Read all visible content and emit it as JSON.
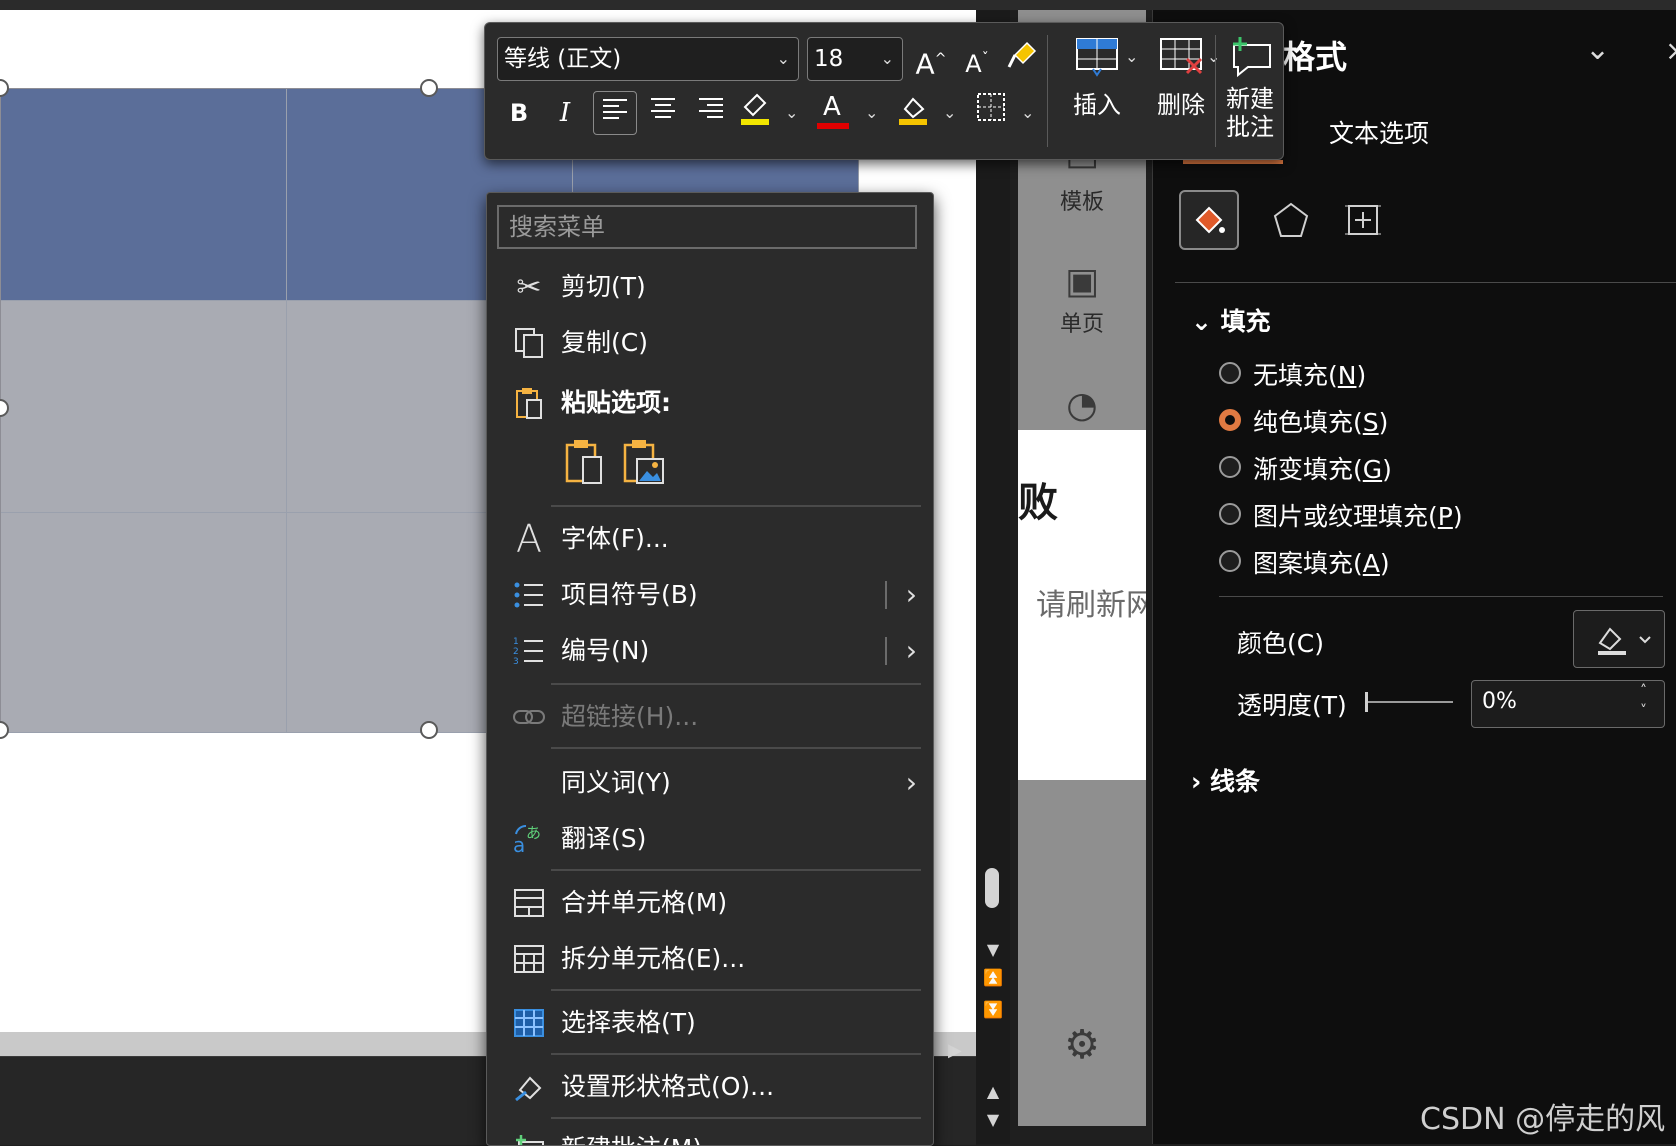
{
  "format_pane": {
    "title_partial": "格式",
    "tab_text_options": "文本选项",
    "fill_section": "填充",
    "fill_options": [
      {
        "label_main": "无填充(",
        "key": "N",
        "close": ")",
        "selected": false
      },
      {
        "label_main": "纯色填充(",
        "key": "S",
        "close": ")",
        "selected": true
      },
      {
        "label_main": "渐变填充(",
        "key": "G",
        "close": ")",
        "selected": false
      },
      {
        "label_main": "图片或纹理填充(",
        "key": "P",
        "close": ")",
        "selected": false
      },
      {
        "label_main": "图案填充(",
        "key": "A",
        "close": ")",
        "selected": false
      }
    ],
    "color_label": "颜色(C)",
    "transparency_label": "透明度(T)",
    "transparency_value": "0%",
    "line_section": "线条",
    "accent_color": "#e07a42"
  },
  "designer": {
    "item_template": "模板",
    "item_single_page": "单页",
    "preview_big_char": "败",
    "preview_text": "请刷新网"
  },
  "mini_toolbar": {
    "font_name": "等线 (正文)",
    "font_size": "18",
    "insert_label": "插入",
    "delete_label": "删除",
    "new_comment_line1": "新建",
    "new_comment_line2": "批注",
    "bold": "B",
    "italic": "I",
    "font_color_glyph": "A",
    "highlight_color": "#f2e600",
    "font_color": "#e00000",
    "fill_color": "#f5c400"
  },
  "context_menu": {
    "search_placeholder": "搜索菜单",
    "cut": "剪切(T)",
    "copy": "复制(C)",
    "paste_options": "粘贴选项:",
    "font": "字体(F)...",
    "bullets": "项目符号(B)",
    "numbering": "编号(N)",
    "hyperlink": "超链接(H)...",
    "synonyms": "同义词(Y)",
    "translate": "翻译(S)",
    "merge_cells": "合并单元格(M)",
    "split_cells": "拆分单元格(E)...",
    "select_table": "选择表格(T)",
    "format_shape": "设置形状格式(O)...",
    "new_comment": "新建批注(M)"
  },
  "table": {
    "header_color": "#5b6e99",
    "body_color": "#a9abb3"
  },
  "watermark": "CSDN @停走的风"
}
